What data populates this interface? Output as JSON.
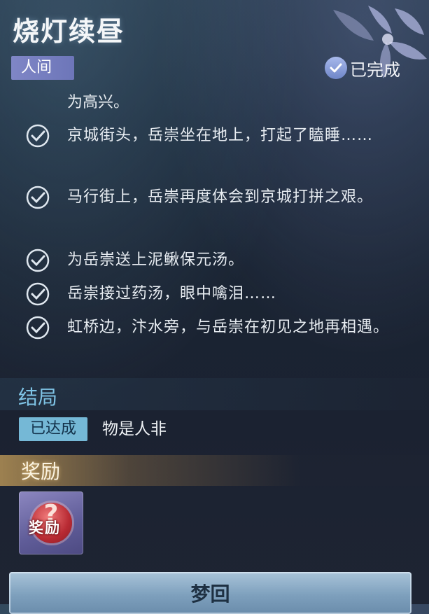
{
  "header": {
    "title": "烧灯续昼",
    "realm_tag": "人间",
    "status_label": "已完成",
    "status_icon": "check-circle-icon"
  },
  "tasks": {
    "continued_text": "为高兴。",
    "items": [
      {
        "text": "京城街头，岳崇坐在地上，打起了瞌睡……",
        "icon": "check-circle-icon"
      },
      {
        "text": "马行街上，岳崇再度体会到京城打拼之艰。",
        "icon": "check-circle-icon"
      },
      {
        "text": "为岳崇送上泥鳅保元汤。",
        "icon": "check-circle-icon"
      },
      {
        "text": "岳崇接过药汤，眼中噙泪……",
        "icon": "check-circle-icon"
      },
      {
        "text": "虹桥边，汴水旁，与岳崇在初见之地再相遇。",
        "icon": "check-circle-icon"
      }
    ]
  },
  "ending": {
    "heading": "结局",
    "tag": "已达成",
    "text": "物是人非"
  },
  "reward": {
    "heading": "奖励",
    "item_label": "奖励",
    "item_icon": "mystery-reward-icon"
  },
  "actions": {
    "return_label": "梦回"
  },
  "colors": {
    "accent_blue": "#7fc4e6",
    "tag_purple": "#7f86c6",
    "ending_tag": "#75b8d6",
    "button": "#8fb0c9"
  }
}
